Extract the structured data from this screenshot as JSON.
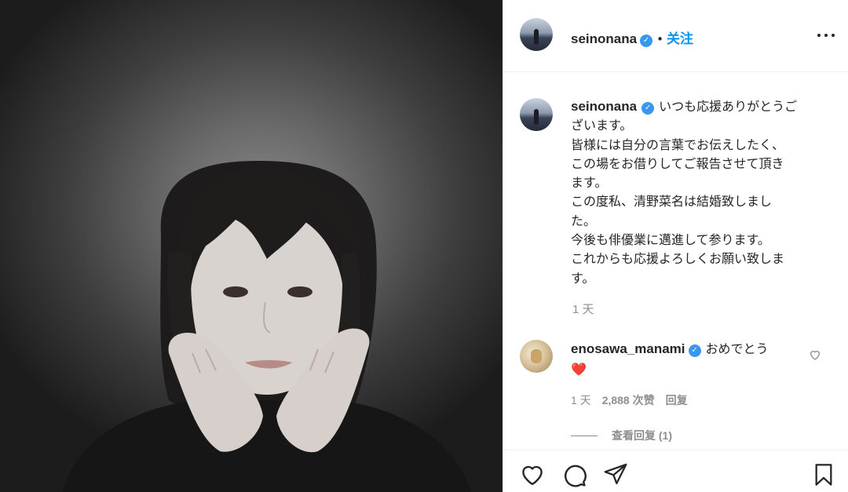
{
  "post": {
    "author": "seinonana",
    "follow_label": "关注",
    "separator": "•",
    "caption_lines": [
      "いつも応援ありがとうご",
      "ざいます。",
      "皆様には自分の言葉でお伝えしたく、",
      "この場をお借りしてご報告させて頂き",
      "ます。",
      "この度私、清野菜名は結婚致しまし",
      "た。",
      "今後も俳優業に邁進して参ります。",
      "これからも応援よろしくお願い致しま",
      "す。"
    ],
    "caption_time": "1 天"
  },
  "comment": {
    "author": "enosawa_manami",
    "text": "おめでとう",
    "emoji": "❤️",
    "time": "1 天",
    "likes": "2,888 次赞",
    "reply_label": "回复",
    "view_replies": "查看回复 (1)"
  },
  "icons": {
    "verified": "verified-badge-icon",
    "more": "more-options-icon",
    "like": "heart-icon",
    "comment": "comment-icon",
    "share": "share-icon",
    "save": "bookmark-icon"
  },
  "colors": {
    "link_blue": "#0095f6",
    "verified_blue": "#3897f0",
    "muted_gray": "#8e8e8e",
    "text": "#262626"
  }
}
